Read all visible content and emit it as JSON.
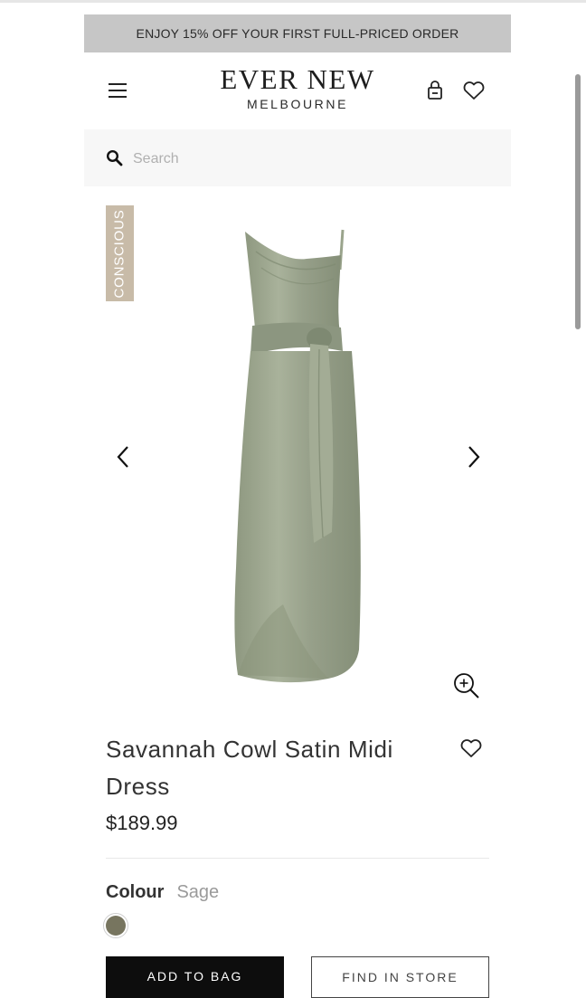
{
  "promo_banner": {
    "text": "ENJOY 15% OFF YOUR FIRST FULL-PRICED ORDER"
  },
  "header": {
    "brand_name": "EVER NEW",
    "brand_location": "MELBOURNE",
    "icons": [
      "menu-icon",
      "bag-icon",
      "heart-icon"
    ]
  },
  "search": {
    "placeholder": "Search",
    "value": ""
  },
  "gallery": {
    "badge": "CONSCIOUS",
    "icons": [
      "chevron-left-icon",
      "chevron-right-icon",
      "zoom-in-icon"
    ]
  },
  "product": {
    "name": "Savannah Cowl Satin Midi Dress",
    "price": "$189.99",
    "colour_label": "Colour",
    "colour_value": "Sage",
    "swatch_color": "#77755f",
    "add_to_bag_label": "ADD TO BAG",
    "find_in_store_label": "FIND IN STORE"
  },
  "colors": {
    "promo_bg": "#c6c6c6",
    "badge_bg": "#c8bba8",
    "dress": "#9aa48c"
  }
}
